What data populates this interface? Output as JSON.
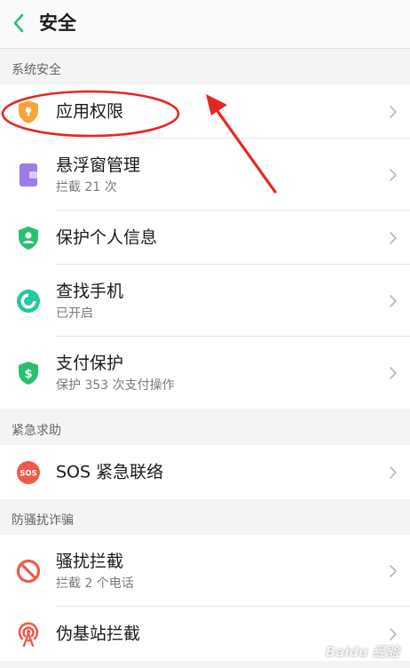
{
  "header": {
    "title": "安全",
    "back_icon": "chevron-left-icon",
    "accent_color": "#2dbd7e"
  },
  "sections": [
    {
      "label": "系统安全",
      "items": [
        {
          "title": "应用权限",
          "subtitle": "",
          "icon": "shield-lock-icon",
          "icon_color": "#f6a53a"
        },
        {
          "title": "悬浮窗管理",
          "subtitle": "拦截 21 次",
          "icon": "floating-window-icon",
          "icon_color": "#9b7ce8"
        },
        {
          "title": "保护个人信息",
          "subtitle": "",
          "icon": "shield-user-icon",
          "icon_color": "#27c16e"
        },
        {
          "title": "查找手机",
          "subtitle": "已开启",
          "icon": "locate-phone-icon",
          "icon_color": "#23c9a0"
        },
        {
          "title": "支付保护",
          "subtitle": "保护 353 次支付操作",
          "icon": "shield-dollar-icon",
          "icon_color": "#27c16e"
        }
      ]
    },
    {
      "label": "紧急求助",
      "items": [
        {
          "title": "SOS 紧急联络",
          "subtitle": "",
          "icon": "sos-icon",
          "icon_color": "#f05a4a",
          "icon_text": "SOS"
        }
      ]
    },
    {
      "label": "防骚扰诈骗",
      "items": [
        {
          "title": "骚扰拦截",
          "subtitle": "拦截 2 个电话",
          "icon": "block-icon",
          "icon_color": "#f05a4a"
        },
        {
          "title": "伪基站拦截",
          "subtitle": "",
          "icon": "signal-tower-icon",
          "icon_color": "#f05a4a"
        }
      ]
    }
  ],
  "annotation": {
    "color": "#e8261f"
  },
  "watermark": "Baidu 经验"
}
